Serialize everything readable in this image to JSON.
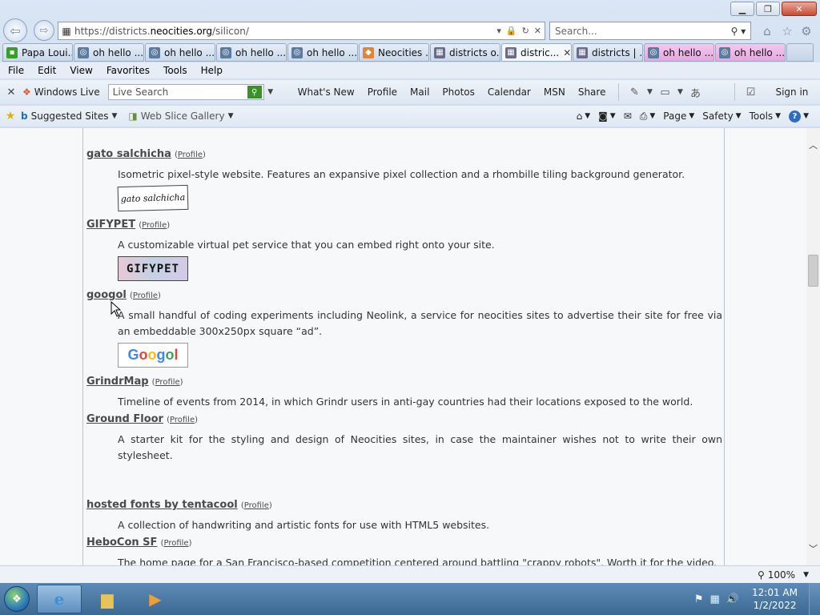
{
  "window": {
    "minimize_label": "▁",
    "maximize_label": "❐",
    "close_label": "✕"
  },
  "address": {
    "url_prefix": "https://districts.",
    "url_domain": "neocities.org",
    "url_path": "/silicon/"
  },
  "search": {
    "placeholder": "Search..."
  },
  "tabs": [
    {
      "label": "Papa Loui...",
      "fav_color": "#3a9d2b",
      "fav": "▪"
    },
    {
      "label": "oh hello ...",
      "fav_color": "#5a7aa0",
      "fav": "◎"
    },
    {
      "label": "oh hello ...",
      "fav_color": "#5a7aa0",
      "fav": "◎"
    },
    {
      "label": "oh hello ...",
      "fav_color": "#5a7aa0",
      "fav": "◎"
    },
    {
      "label": "oh hello ...",
      "fav_color": "#5a7aa0",
      "fav": "◎"
    },
    {
      "label": "Neocities ...",
      "fav_color": "#e0843a",
      "fav": "◆"
    },
    {
      "label": "districts o...",
      "fav_color": "#6a6a8a",
      "fav": "▦"
    },
    {
      "label": "distric...",
      "fav_color": "#6a6a8a",
      "fav": "▦",
      "active": true
    },
    {
      "label": "districts | ...",
      "fav_color": "#6a6a8a",
      "fav": "▦"
    },
    {
      "label": "oh hello ...",
      "fav_color": "#5a7aa0",
      "fav": "◎",
      "pink": true
    },
    {
      "label": "oh hello ...",
      "fav_color": "#5a7aa0",
      "fav": "◎",
      "pink": true
    }
  ],
  "menu": [
    "File",
    "Edit",
    "View",
    "Favorites",
    "Tools",
    "Help"
  ],
  "livebar": {
    "brand": "Windows Live",
    "search_placeholder": "Live Search",
    "links": [
      "What's New",
      "Profile",
      "Mail",
      "Photos",
      "Calendar",
      "MSN",
      "Share"
    ],
    "sign_in": "Sign in"
  },
  "favbar": {
    "suggested": "Suggested Sites",
    "webslice": "Web Slice Gallery",
    "commands": [
      "Page",
      "Safety",
      "Tools"
    ]
  },
  "sites": [
    {
      "name": "gato salchicha",
      "profile": "Profile",
      "desc": "Isometric pixel-style website. Features an expansive pixel collection and a rhombille tiling background generator.",
      "badge": "gato salchicha"
    },
    {
      "name": "GIFYPET",
      "profile": "Profile",
      "desc": "A customizable virtual pet service that you can embed right onto your site.",
      "badge": "GIFYPET"
    },
    {
      "name": "googol",
      "profile": "Profile",
      "desc": "A small handful of coding experiments including Neolink, a service for neocities sites to advertise their site for free via an embeddable 300x250px square “ad”.",
      "badge": "Googol"
    },
    {
      "name": "GrindrMap",
      "profile": "Profile",
      "desc": "Timeline of events from 2014, in which Grindr users in anti-gay countries had their locations exposed to the world."
    },
    {
      "name": "Ground Floor",
      "profile": "Profile",
      "desc": "A starter kit for the styling and design of Neocities sites, in case the maintainer wishes not to write their own stylesheet."
    },
    {
      "name": "hosted fonts by tentacool",
      "profile": "Profile",
      "desc": "A collection of handwriting and artistic fonts for use with HTML5 websites."
    },
    {
      "name": "HeboCon SF",
      "profile": "Profile",
      "desc": "The home page for a San Francisco-based competition centered around battling \"crappy robots\". Worth it for the video."
    }
  ],
  "status": {
    "zoom": "100%"
  },
  "taskbar": {
    "time": "12:01 AM",
    "date": "1/2/2022"
  }
}
